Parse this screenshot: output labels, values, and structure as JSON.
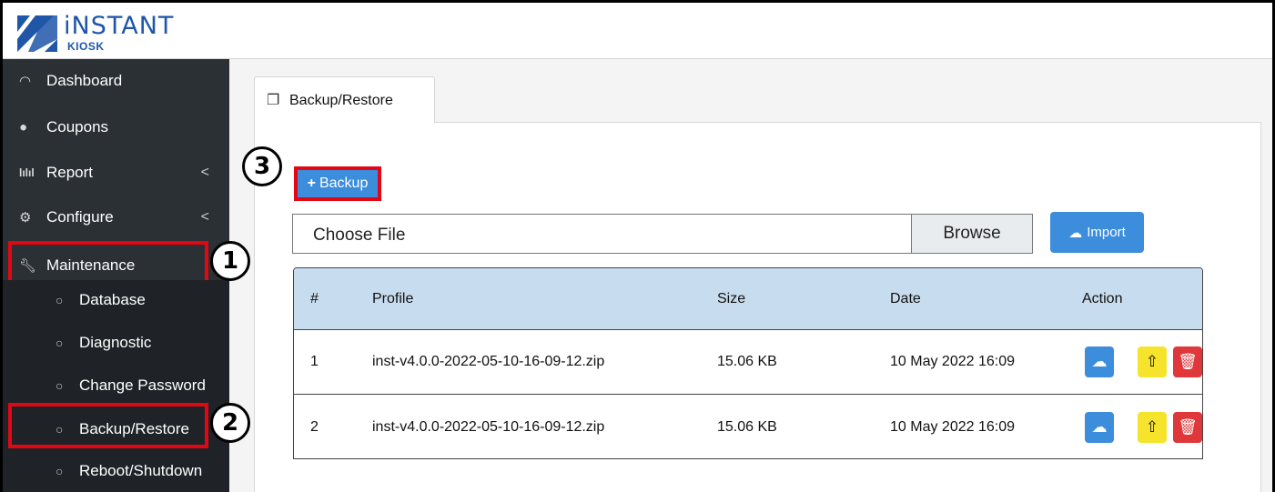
{
  "brand": {
    "name": "iNSTANT",
    "sub": "KIOSK",
    "color": "#1f56a8"
  },
  "sidebar": {
    "items": [
      {
        "icon": "gauge-icon",
        "label": "Dashboard"
      },
      {
        "icon": "tag-icon",
        "label": "Coupons"
      },
      {
        "icon": "bar-chart-icon",
        "label": "Report",
        "chevron": "<"
      },
      {
        "icon": "gear-icon",
        "label": "Configure",
        "chevron": "<"
      },
      {
        "icon": "wrench-icon",
        "label": "Maintenance"
      }
    ],
    "subitems": [
      {
        "icon": "circle-icon",
        "label": "Database"
      },
      {
        "icon": "circle-icon",
        "label": "Diagnostic"
      },
      {
        "icon": "circle-icon",
        "label": "Change Password"
      },
      {
        "icon": "circle-icon",
        "label": "Backup/Restore"
      },
      {
        "icon": "circle-icon",
        "label": "Reboot/Shutdown"
      }
    ]
  },
  "tab": {
    "icon": "copy-icon",
    "label": "Backup/Restore"
  },
  "backup_button": {
    "icon": "+",
    "label": "Backup"
  },
  "file_input": {
    "placeholder": "Choose File",
    "browse_label": "Browse"
  },
  "import_button": {
    "icon": "cloud-upload-icon",
    "label": "Import"
  },
  "table": {
    "headers": [
      "#",
      "Profile",
      "Size",
      "Date",
      "Action"
    ],
    "rows": [
      {
        "num": "1",
        "profile": "inst-v4.0.0-2022-05-10-16-09-12.zip",
        "size": "15.06 KB",
        "date": "10 May 2022 16:09"
      },
      {
        "num": "2",
        "profile": "inst-v4.0.0-2022-05-10-16-09-12.zip",
        "size": "15.06 KB",
        "date": "10 May 2022 16:09"
      }
    ]
  },
  "callouts": [
    "1",
    "2",
    "3"
  ],
  "colors": {
    "sidebar_bg": "#2b3035",
    "accent_blue": "#3c8ddc",
    "warning_yellow": "#f5e42b",
    "danger_red": "#e0373a",
    "highlight_red": "#e30613",
    "table_header": "#c8dcef"
  }
}
